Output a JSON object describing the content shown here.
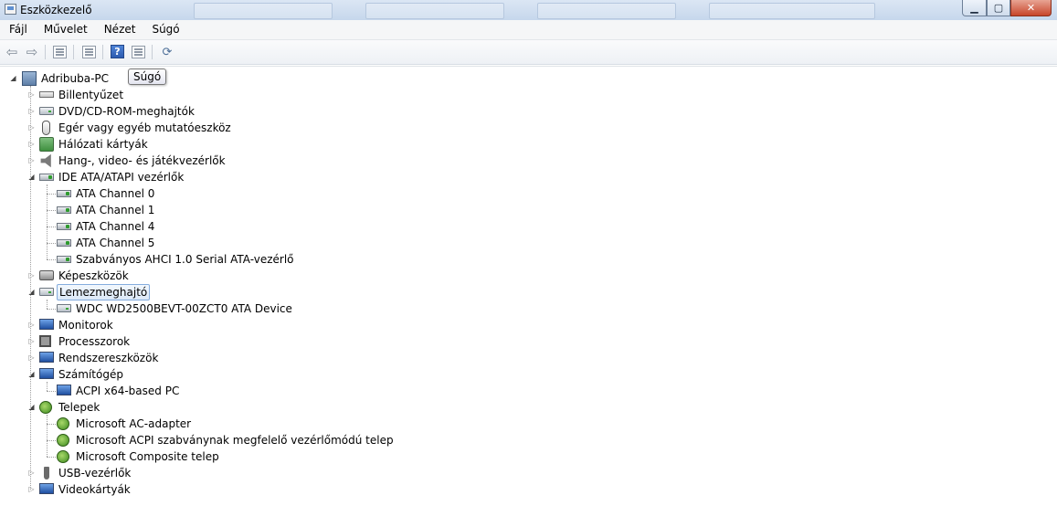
{
  "window": {
    "title": "Eszközkezelő",
    "buttons": {
      "minimize": "▁",
      "maximize": "▢",
      "close": "✕"
    }
  },
  "menu": [
    "Fájl",
    "Művelet",
    "Nézet",
    "Súgó"
  ],
  "toolbar": {
    "icons": [
      "back-arrow-icon",
      "forward-arrow-icon",
      "properties-icon",
      "list-view-icon",
      "help-icon",
      "show-hide-icon",
      "scan-hardware-icon"
    ],
    "back": "⇦",
    "forward": "⇨",
    "help": "?",
    "scan": "⟳"
  },
  "tooltip": "Súgó",
  "tree": {
    "root": "Adribuba-PC",
    "categories": [
      {
        "label": "Billentyűzet",
        "icon": "keyboard-icon",
        "expanded": false,
        "children": []
      },
      {
        "label": "DVD/CD-ROM-meghajtók",
        "icon": "dvd-drive-icon",
        "expanded": false,
        "children": []
      },
      {
        "label": "Egér vagy egyéb mutatóeszköz",
        "icon": "mouse-icon",
        "expanded": false,
        "children": []
      },
      {
        "label": "Hálózati kártyák",
        "icon": "network-card-icon",
        "expanded": false,
        "children": []
      },
      {
        "label": "Hang-, video- és játékvezérlők",
        "icon": "sound-icon",
        "expanded": false,
        "children": []
      },
      {
        "label": "IDE ATA/ATAPI vezérlők",
        "icon": "ide-controller-icon",
        "expanded": true,
        "children": [
          "ATA Channel 0",
          "ATA Channel 1",
          "ATA Channel 4",
          "ATA Channel 5",
          "Szabványos AHCI 1.0 Serial ATA-vezérlő"
        ]
      },
      {
        "label": "Képeszközök",
        "icon": "camera-icon",
        "expanded": false,
        "children": []
      },
      {
        "label": "Lemezmeghajtó",
        "icon": "disk-drive-icon",
        "expanded": true,
        "selected": true,
        "children": [
          "WDC WD2500BEVT-00ZCT0 ATA Device"
        ]
      },
      {
        "label": "Monitorok",
        "icon": "monitor-icon",
        "expanded": false,
        "children": []
      },
      {
        "label": "Processzorok",
        "icon": "processor-icon",
        "expanded": false,
        "children": []
      },
      {
        "label": "Rendszereszközök",
        "icon": "system-devices-icon",
        "expanded": false,
        "children": []
      },
      {
        "label": "Számítógép",
        "icon": "computer-icon",
        "expanded": true,
        "children": [
          "ACPI x64-based PC"
        ]
      },
      {
        "label": "Telepek",
        "icon": "battery-icon",
        "expanded": true,
        "children": [
          "Microsoft AC-adapter",
          "Microsoft ACPI szabványnak megfelelő vezérlőmódú telep",
          "Microsoft Composite telep"
        ]
      },
      {
        "label": "USB-vezérlők",
        "icon": "usb-icon",
        "expanded": false,
        "children": []
      },
      {
        "label": "Videokártyák",
        "icon": "video-card-icon",
        "expanded": false,
        "children": []
      }
    ]
  }
}
